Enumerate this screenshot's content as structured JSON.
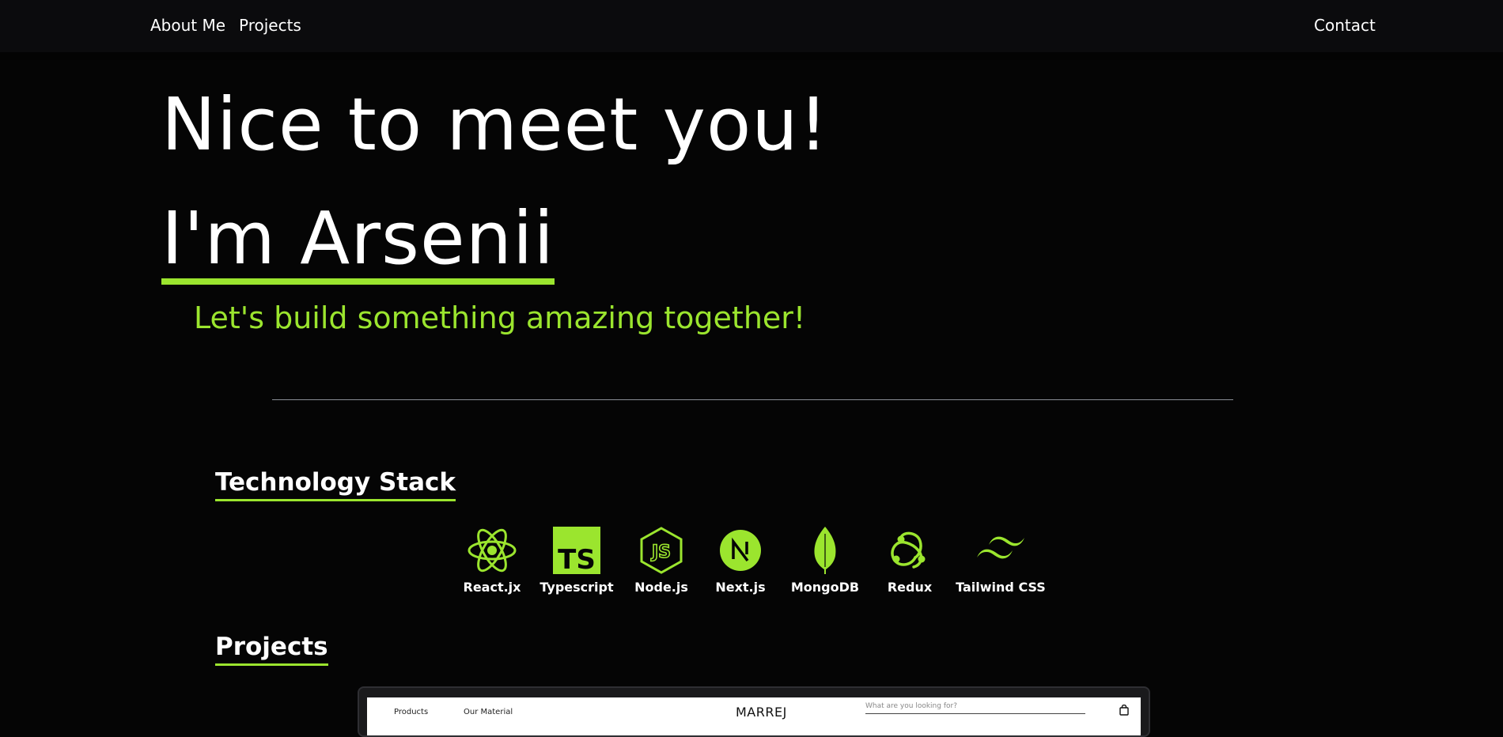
{
  "nav": {
    "about": "About Me",
    "projects": "Projects",
    "contact": "Contact"
  },
  "hero": {
    "title": "Nice to meet you!",
    "name": "I'm Arsenii",
    "tagline": "Let's build something amazing together!"
  },
  "tech_section": {
    "title": "Technology Stack",
    "items": [
      {
        "label": "React.jx",
        "icon": "react-icon"
      },
      {
        "label": "Typescript",
        "icon": "typescript-icon"
      },
      {
        "label": "Node.js",
        "icon": "nodejs-icon"
      },
      {
        "label": "Next.js",
        "icon": "nextjs-icon"
      },
      {
        "label": "MongoDB",
        "icon": "mongodb-icon"
      },
      {
        "label": "Redux",
        "icon": "redux-icon"
      },
      {
        "label": "Tailwind CSS",
        "icon": "tailwind-icon"
      }
    ]
  },
  "projects_section": {
    "title": "Projects",
    "preview": {
      "link1": "Products",
      "link2": "Our Material",
      "brand": "MARREJ",
      "search_placeholder": "What are you looking for?",
      "bag_icon": "shopping-bag-icon"
    }
  },
  "colors": {
    "accent": "#9be52e",
    "background": "#050505",
    "nav_background": "#0b0b0d"
  }
}
